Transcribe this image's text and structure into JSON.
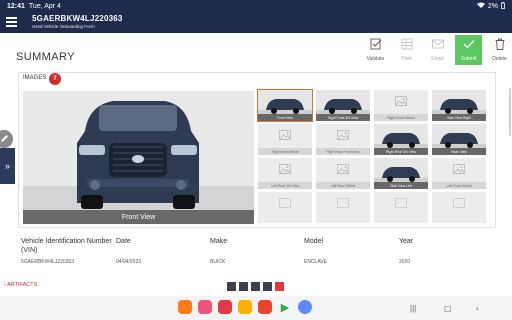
{
  "status": {
    "time": "12:41",
    "date": "Tue, Apr 4",
    "battery": "2%"
  },
  "header": {
    "vin": "5GAERBKW4LJ220363",
    "subtitle": "Used Vehicle Onboarding Form"
  },
  "page": {
    "title": "SUMMARY"
  },
  "toolbar": [
    {
      "label": "Validate",
      "icon": "validate-icon",
      "state": "enabled"
    },
    {
      "label": "Print",
      "icon": "print-icon",
      "state": "disabled"
    },
    {
      "label": "Email",
      "icon": "email-icon",
      "state": "disabled"
    },
    {
      "label": "Submit",
      "icon": "check-icon",
      "state": "primary"
    },
    {
      "label": "Delete",
      "icon": "trash-icon",
      "state": "enabled"
    }
  ],
  "images": {
    "label": "IMAGES",
    "count": "7",
    "main_caption": "Front View",
    "thumbs": [
      {
        "label": "Front View",
        "has_photo": true,
        "selected": true
      },
      {
        "label": "Right Front 3/4 View",
        "has_photo": true
      },
      {
        "label": "Right Front Wheel",
        "has_photo": false
      },
      {
        "label": "Side View Right",
        "has_photo": true
      },
      {
        "label": "Right Rear Wheel",
        "has_photo": false
      },
      {
        "label": "Right Rear Front View",
        "has_photo": false
      },
      {
        "label": "Right Rear 3/4 View",
        "has_photo": true
      },
      {
        "label": "Rear View",
        "has_photo": true
      },
      {
        "label": "Left Rear 3/4 View",
        "has_photo": false
      },
      {
        "label": "Left Rear Wheel",
        "has_photo": false
      },
      {
        "label": "Side View Left",
        "has_photo": true
      },
      {
        "label": "Left Front Wheel",
        "has_photo": false
      },
      {
        "label": "",
        "has_photo": false
      },
      {
        "label": "",
        "has_photo": false
      },
      {
        "label": "",
        "has_photo": false
      },
      {
        "label": "",
        "has_photo": false
      }
    ]
  },
  "vehicle": {
    "vin_label": "Vehicle Identification Number (VIN)",
    "vin_value": "5GAERBKW4LJ220363",
    "date_label": "Date",
    "date_value": "04/04/2023",
    "make_label": "Make",
    "make_value": "BUICK",
    "model_label": "Model",
    "model_value": "ENCLAVE",
    "year_label": "Year",
    "year_value": "2020"
  },
  "footer": {
    "back_label": "ARTIFACTS",
    "pages": 5,
    "active_page": 5
  },
  "colors": {
    "header_bg": "#1f2b4d",
    "submit": "#5cc761",
    "badge": "#c93131",
    "selected_outline": "#d9722a"
  }
}
